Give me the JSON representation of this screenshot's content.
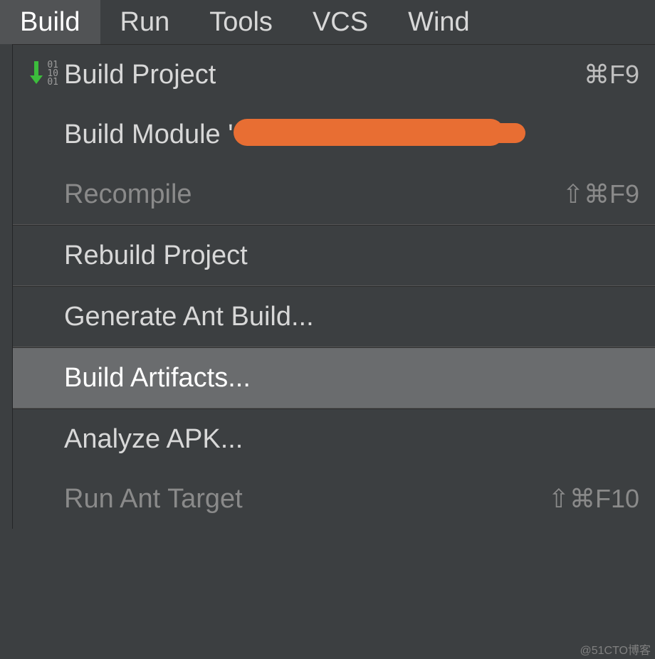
{
  "menubar": {
    "items": [
      {
        "label": "Build",
        "selected": true
      },
      {
        "label": "Run"
      },
      {
        "label": "Tools"
      },
      {
        "label": "VCS"
      },
      {
        "label": "Wind"
      }
    ]
  },
  "dropdown": {
    "groups": [
      [
        {
          "id": "build-project",
          "label": "Build Project",
          "shortcut": "⌘F9",
          "icon": "build-icon",
          "enabled": true
        },
        {
          "id": "build-module",
          "label_prefix": "Build Module '",
          "label_suffix": "'",
          "redacted": true,
          "enabled": true
        },
        {
          "id": "recompile",
          "label": "Recompile",
          "shortcut": "⇧⌘F9",
          "enabled": false
        }
      ],
      [
        {
          "id": "rebuild-project",
          "label": "Rebuild Project",
          "enabled": true
        }
      ],
      [
        {
          "id": "generate-ant",
          "label": "Generate Ant Build...",
          "enabled": true
        }
      ],
      [
        {
          "id": "build-artifacts",
          "label": "Build Artifacts...",
          "enabled": true,
          "hovered": true
        }
      ],
      [
        {
          "id": "analyze-apk",
          "label": "Analyze APK...",
          "enabled": true
        },
        {
          "id": "run-ant-target",
          "label": "Run Ant Target",
          "shortcut": "⇧⌘F10",
          "enabled": false
        }
      ]
    ]
  },
  "watermark": "@51CTO博客"
}
